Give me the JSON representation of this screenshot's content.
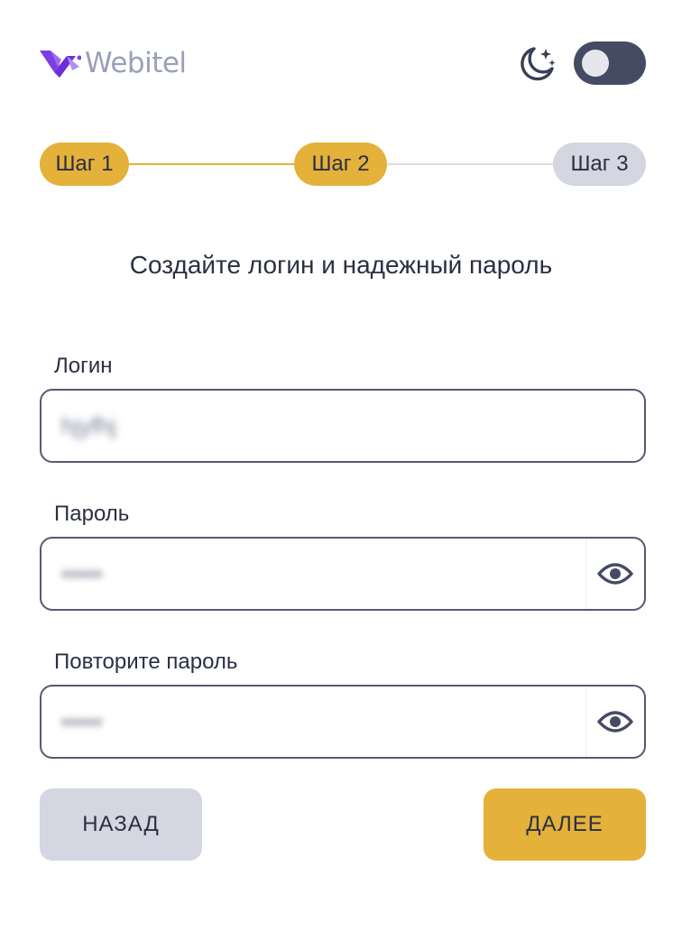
{
  "header": {
    "brand": "Webitel",
    "theme_toggle_on": true
  },
  "stepper": {
    "steps": [
      {
        "label": "Шаг 1",
        "state": "done"
      },
      {
        "label": "Шаг 2",
        "state": "active"
      },
      {
        "label": "Шаг 3",
        "state": "pending"
      }
    ]
  },
  "form": {
    "title": "Создайте логин и надежный пароль",
    "login": {
      "label": "Логин",
      "value": "hjyfhj"
    },
    "password": {
      "label": "Пароль",
      "value": "•••••"
    },
    "repeat_password": {
      "label": "Повторите пароль",
      "value": "•••••"
    }
  },
  "actions": {
    "back_label": "НАЗАД",
    "next_label": "ДАЛЕЕ"
  },
  "colors": {
    "accent": "#e4b13b",
    "inactive": "#d4d6e1",
    "toggle_bg": "#454b63",
    "text": "#2b2f42",
    "logo_purple": "#7b3fe4",
    "logo_text": "#9a9fb8"
  },
  "icons": {
    "theme": "moon-stars-icon",
    "visibility": "eye-icon",
    "logo": "webitel-logo-icon"
  }
}
